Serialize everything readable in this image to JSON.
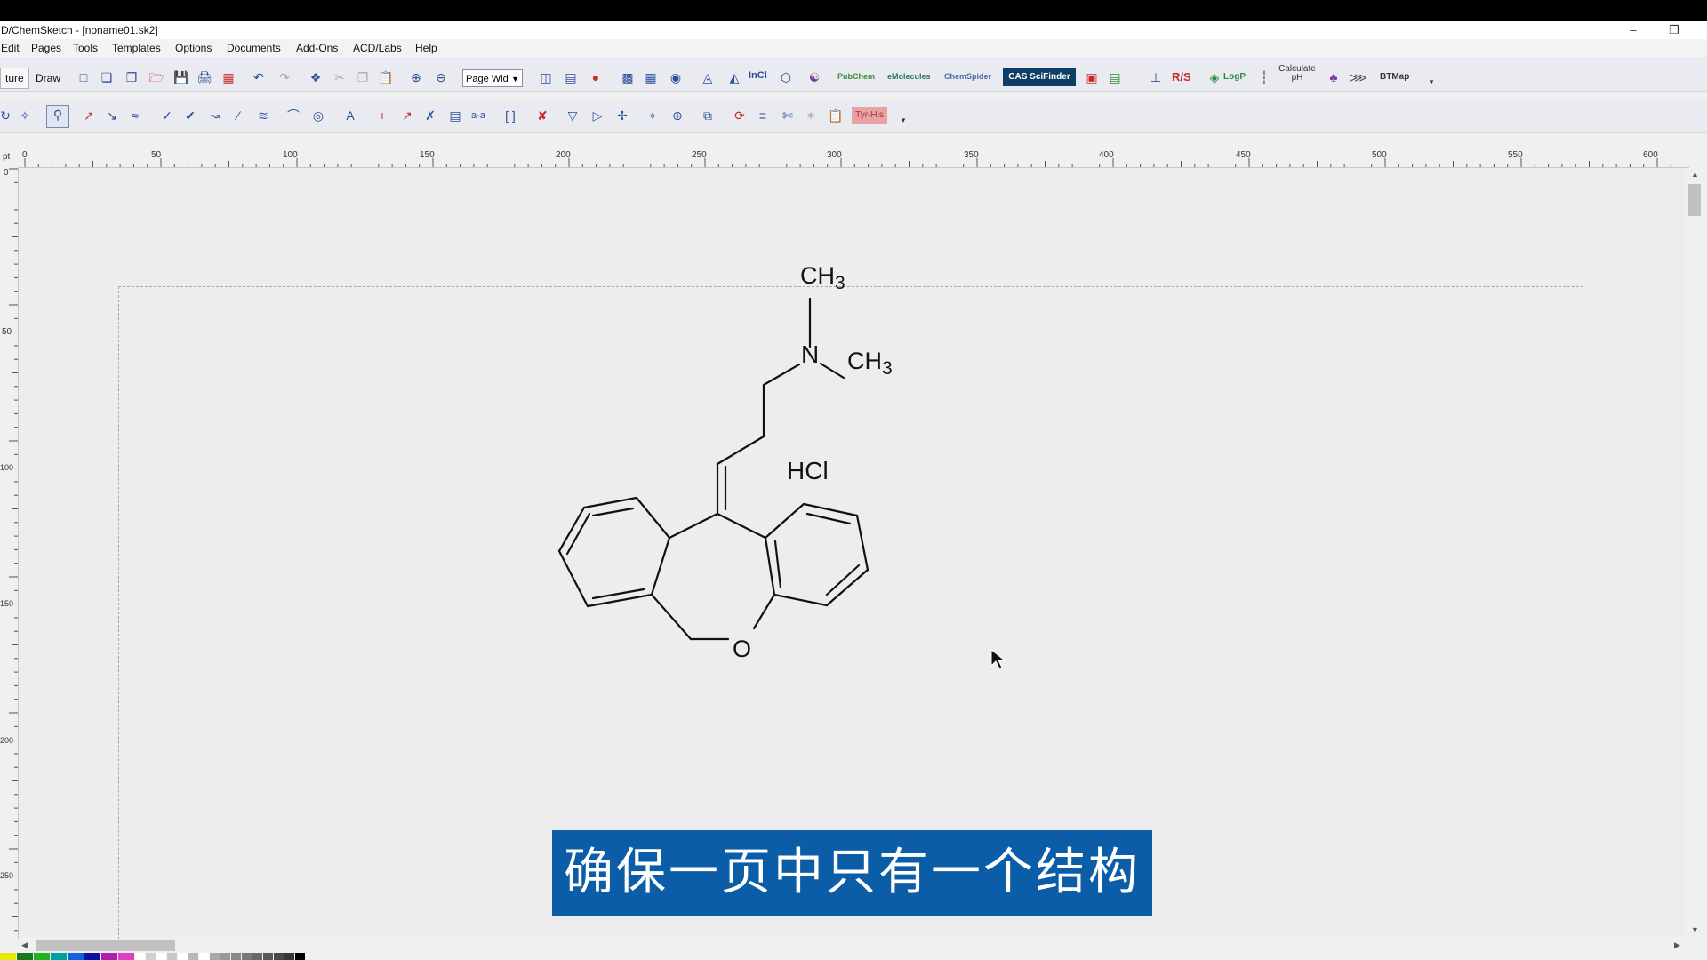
{
  "window": {
    "title": "D/ChemSketch - [noname01.sk2]",
    "minimize": "–",
    "restore": "❐"
  },
  "menu": [
    {
      "label": "Edit"
    },
    {
      "label": "Pages"
    },
    {
      "label": "Tools"
    },
    {
      "label": "Templates"
    },
    {
      "label": "Options"
    },
    {
      "label": "Documents"
    },
    {
      "label": "Add-Ons"
    },
    {
      "label": "ACD/Labs"
    },
    {
      "label": "Help"
    }
  ],
  "toolbar": {
    "mode_structure": "ture",
    "mode_draw": "Draw",
    "zoom_value": "Page Wid",
    "pubchem": "PubChem",
    "emolecules": "eMolecules",
    "chemspider": "ChemSpider",
    "scifinder": "CAS SciFinder",
    "rs": "R/S",
    "logp": "LogP",
    "calculate_ph": "Calculate pH",
    "btmap": "BTMap"
  },
  "ruler": {
    "unit": "pt",
    "top_labels": [
      "0",
      "50",
      "100",
      "150",
      "200",
      "250",
      "300",
      "350",
      "400",
      "450",
      "500",
      "550",
      "600"
    ],
    "left_labels": [
      "0",
      "50",
      "100",
      "150",
      "200",
      "250"
    ]
  },
  "structure": {
    "labels": {
      "ch3_top": "CH3",
      "n": "N",
      "ch3_right": "CH3",
      "hcl": "HCl",
      "o": "O"
    }
  },
  "subtitle": "确保一页中只有一个结构",
  "colors": {
    "subtitle_bg": "#0a5da6",
    "canvas_bg": "#ededed",
    "toolbar_bg": "#e9ebf1",
    "scifinder_bg": "#0e3d66"
  }
}
